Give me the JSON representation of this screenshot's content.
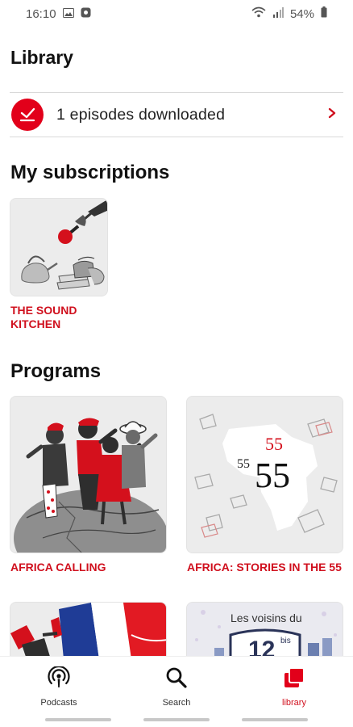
{
  "status": {
    "time": "16:10",
    "battery": "54%"
  },
  "page": {
    "title": "Library"
  },
  "downloads": {
    "text": "1 episodes downloaded"
  },
  "subscriptions": {
    "title": "My subscriptions",
    "items": [
      {
        "label": "THE SOUND KITCHEN"
      }
    ]
  },
  "programs": {
    "title": "Programs",
    "items": [
      {
        "label": "AFRICA CALLING"
      },
      {
        "label": "AFRICA: STORIES IN THE 55"
      },
      {
        "label": ""
      },
      {
        "label": "",
        "art_text_1": "Les voisins du",
        "art_text_2": "12",
        "art_text_3": "bis"
      }
    ],
    "art_55": {
      "small": "55",
      "red": "55",
      "big": "55"
    }
  },
  "nav": {
    "items": [
      {
        "label": "Podcasts",
        "icon": "podcasts-icon"
      },
      {
        "label": "Search",
        "icon": "search-icon"
      },
      {
        "label": "library",
        "icon": "library-icon"
      }
    ]
  },
  "colors": {
    "accent": "#e2001a",
    "label_red": "#d0101e"
  }
}
